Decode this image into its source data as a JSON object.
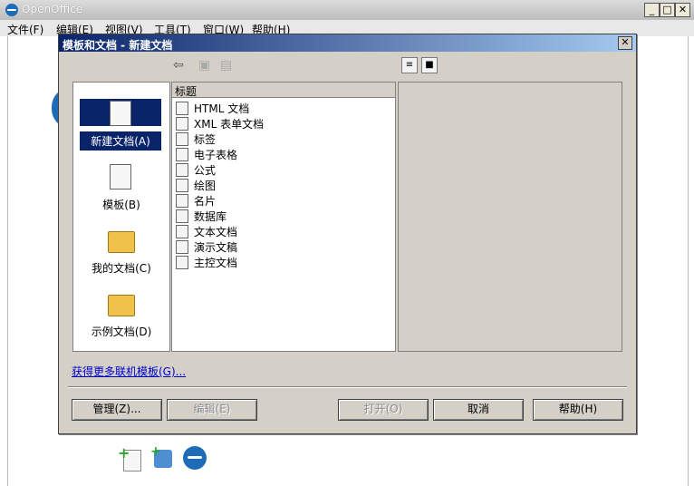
{
  "window": {
    "title": "OpenOffice",
    "min": "_",
    "max": "□",
    "close": "✕"
  },
  "menu": [
    "文件(F)",
    "编辑(E)",
    "视图(V)",
    "工具(T)",
    "窗口(W)",
    "帮助(H)"
  ],
  "dialog": {
    "title": "模板和文档 - 新建文档",
    "close": "✕",
    "categories": [
      {
        "label": "新建文档(A)",
        "selected": true
      },
      {
        "label": "模板(B)",
        "selected": false
      },
      {
        "label": "我的文档(C)",
        "selected": false
      },
      {
        "label": "示例文档(D)",
        "selected": false
      }
    ],
    "list_header": "标题",
    "items": [
      "HTML 文档",
      "XML 表单文档",
      "标签",
      "电子表格",
      "公式",
      "绘图",
      "名片",
      "数据库",
      "文本文档",
      "演示文稿",
      "主控文档"
    ],
    "link": "获得更多联机模板(G)...",
    "buttons": {
      "manage": "管理(Z)...",
      "edit": "编辑(E)",
      "open": "打开(O)",
      "cancel": "取消",
      "help": "帮助(H)"
    }
  },
  "colors": {
    "dialog_bg": "#d4d0c8",
    "selection": "#0a246a",
    "link": "#0000cc"
  }
}
